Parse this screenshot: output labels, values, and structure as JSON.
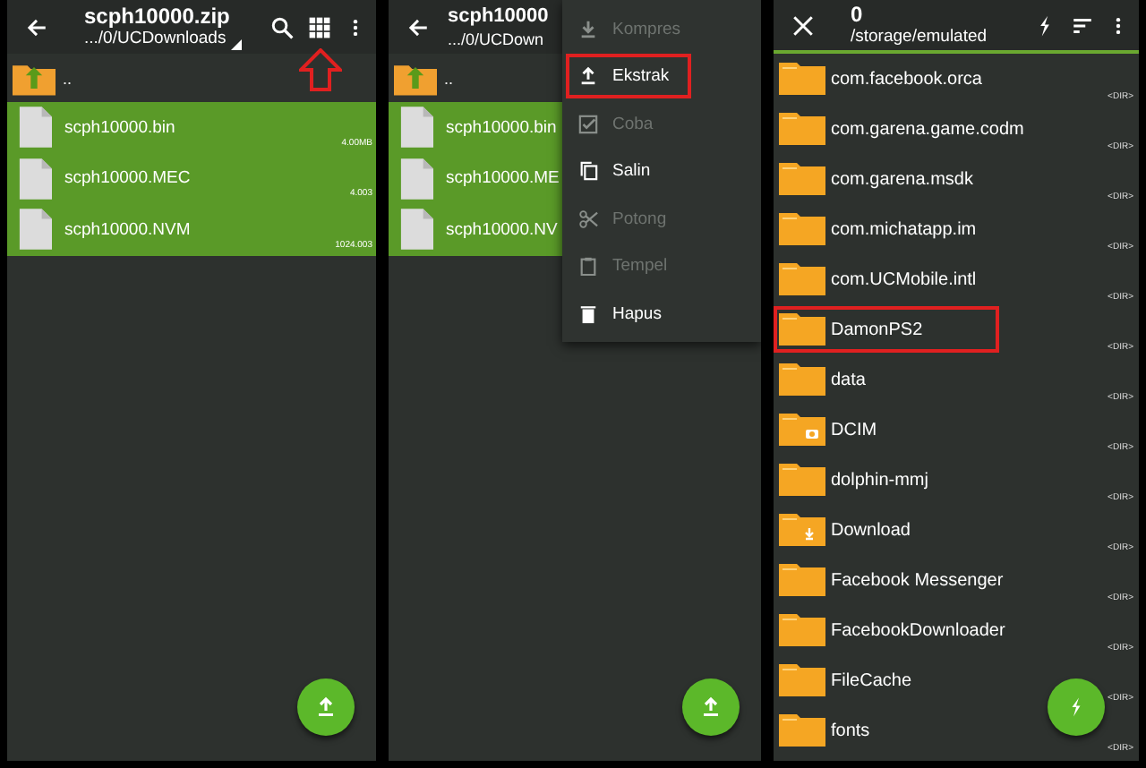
{
  "archive_view": {
    "title": "scph10000.zip",
    "path": ".../0/UCDownloads",
    "up_label": "..",
    "grid_button_marked": true,
    "files": [
      {
        "name": "scph10000.bin",
        "size": "4.00MB",
        "selected": true
      },
      {
        "name": "scph10000.MEC",
        "size": "4.003",
        "selected": true
      },
      {
        "name": "scph10000.NVM",
        "size": "1024.003",
        "selected": true
      }
    ]
  },
  "menu_view": {
    "title": "scph10000",
    "path": ".../0/UCDown",
    "up_label": "..",
    "files": [
      {
        "name": "scph10000.bin",
        "selected": true
      },
      {
        "name": "scph10000.ME",
        "selected": true
      },
      {
        "name": "scph10000.NV",
        "selected": true
      }
    ],
    "menu": [
      {
        "label": "Kompres",
        "kind": "compress",
        "disabled": true,
        "marked": false
      },
      {
        "label": "Ekstrak",
        "kind": "extract",
        "disabled": false,
        "marked": true
      },
      {
        "label": "Coba",
        "kind": "test",
        "disabled": true,
        "marked": false
      },
      {
        "label": "Salin",
        "kind": "copy",
        "disabled": false,
        "marked": false
      },
      {
        "label": "Potong",
        "kind": "cut",
        "disabled": true,
        "marked": false
      },
      {
        "label": "Tempel",
        "kind": "paste",
        "disabled": true,
        "marked": false
      },
      {
        "label": "Hapus",
        "kind": "delete",
        "disabled": false,
        "marked": false
      }
    ]
  },
  "folder_view": {
    "title": "0",
    "path": "/storage/emulated",
    "folders": [
      {
        "name": "com.facebook.orca",
        "kind": "plain",
        "size": "<DIR>",
        "marked": false
      },
      {
        "name": "com.garena.game.codm",
        "kind": "plain",
        "size": "<DIR>",
        "marked": false
      },
      {
        "name": "com.garena.msdk",
        "kind": "plain",
        "size": "<DIR>",
        "marked": false
      },
      {
        "name": "com.michatapp.im",
        "kind": "plain",
        "size": "<DIR>",
        "marked": false
      },
      {
        "name": "com.UCMobile.intl",
        "kind": "plain",
        "size": "<DIR>",
        "marked": false
      },
      {
        "name": "DamonPS2",
        "kind": "plain",
        "size": "<DIR>",
        "marked": true
      },
      {
        "name": "data",
        "kind": "plain",
        "size": "<DIR>",
        "marked": false
      },
      {
        "name": "DCIM",
        "kind": "camera",
        "size": "<DIR>",
        "marked": false
      },
      {
        "name": "dolphin-mmj",
        "kind": "plain",
        "size": "<DIR>",
        "marked": false
      },
      {
        "name": "Download",
        "kind": "download",
        "size": "<DIR>",
        "marked": false
      },
      {
        "name": "Facebook Messenger",
        "kind": "plain",
        "size": "<DIR>",
        "marked": false
      },
      {
        "name": "FacebookDownloader",
        "kind": "plain",
        "size": "<DIR>",
        "marked": false
      },
      {
        "name": "FileCache",
        "kind": "plain",
        "size": "<DIR>",
        "marked": false
      },
      {
        "name": "fonts",
        "kind": "plain",
        "size": "<DIR>",
        "marked": false
      }
    ]
  }
}
